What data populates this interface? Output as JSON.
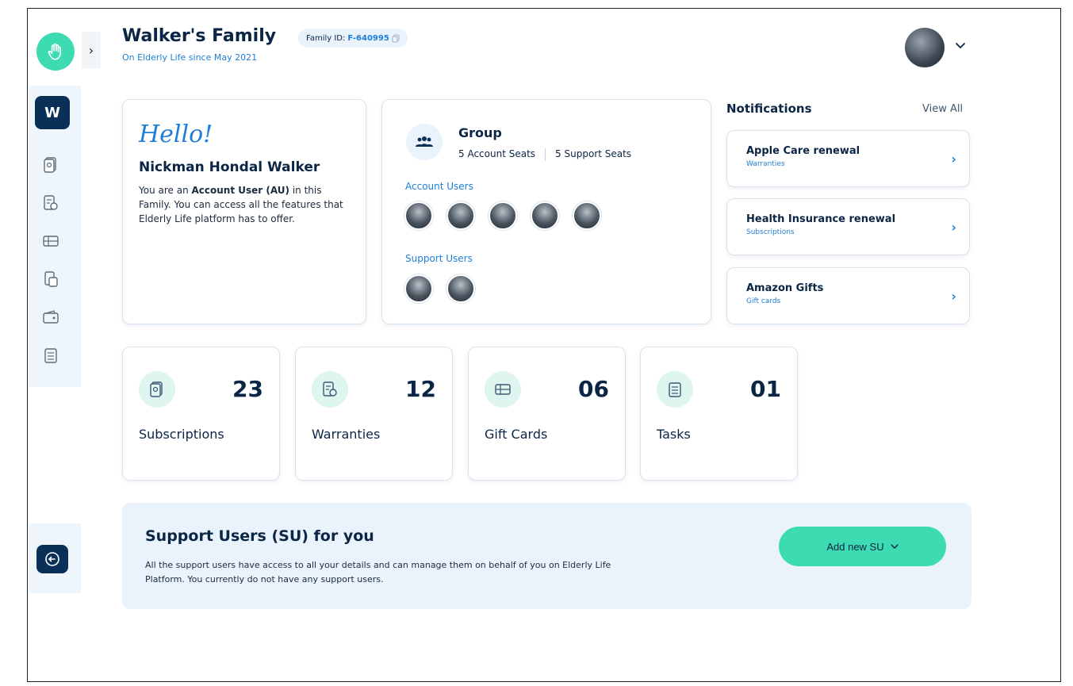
{
  "header": {
    "family_title": "Walker's Family",
    "since": "On Elderly Life since May 2021",
    "family_id_label": "Family ID:",
    "family_id_value": "F-640995"
  },
  "sidebar": {
    "badge_letter": "W",
    "items": [
      {
        "icon": "subscriptions-icon"
      },
      {
        "icon": "warranties-icon"
      },
      {
        "icon": "gift-cards-icon"
      },
      {
        "icon": "documents-icon"
      },
      {
        "icon": "wallet-icon"
      },
      {
        "icon": "tasks-icon"
      }
    ]
  },
  "hello": {
    "greeting": "Hello!",
    "name": "Nickman Hondal Walker",
    "desc_prefix": "You are an ",
    "desc_role": "Account User (AU)",
    "desc_suffix": " in this Family. You can access all the features that Elderly Life platform has to offer."
  },
  "group": {
    "title": "Group",
    "account_seats": "5 Account Seats",
    "support_seats": "5 Support Seats",
    "account_users_label": "Account Users",
    "support_users_label": "Support Users",
    "account_user_count": 5,
    "support_user_count": 2
  },
  "notifications": {
    "title": "Notifications",
    "view_all": "View All",
    "items": [
      {
        "name": "Apple Care renewal",
        "category": "Warranties"
      },
      {
        "name": "Health Insurance renewal",
        "category": "Subscriptions"
      },
      {
        "name": "Amazon Gifts",
        "category": "Gift cards"
      }
    ]
  },
  "stats": [
    {
      "value": "23",
      "label": "Subscriptions",
      "icon": "subscriptions-icon"
    },
    {
      "value": "12",
      "label": "Warranties",
      "icon": "warranties-icon"
    },
    {
      "value": "06",
      "label": "Gift Cards",
      "icon": "gift-cards-icon"
    },
    {
      "value": "01",
      "label": "Tasks",
      "icon": "tasks-icon"
    }
  ],
  "support_users": {
    "title": "Support Users (SU) for you",
    "desc": "All the support users have access to all your details and can manage them on behalf of you on Elderly Life Platform. You currently do not have any support users.",
    "button_label": "Add new SU"
  },
  "colors": {
    "brand_teal": "#3ddbb2",
    "navy": "#0b3058",
    "link_blue": "#1e7fd8"
  }
}
